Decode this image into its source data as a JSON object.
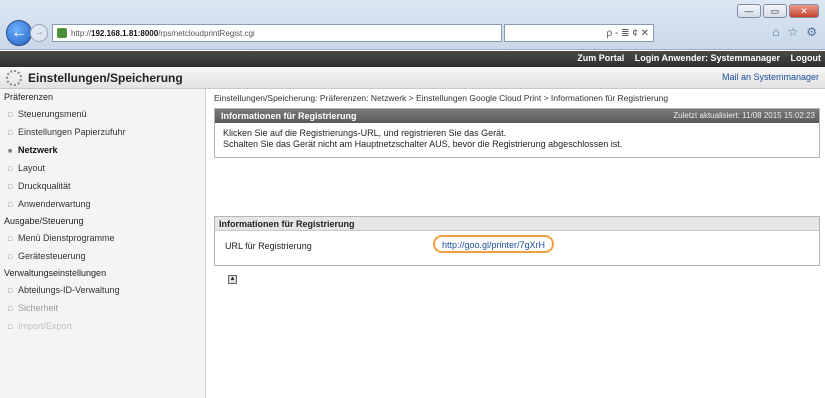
{
  "browser": {
    "url_host": "192.168.1.81:8000",
    "url_prefix": "http://",
    "url_path": "/rps/netcloudprintRegist.cgi",
    "search_tools": "ρ - ≣ ¢ ✕",
    "window_controls": [
      "—",
      "▭",
      "✕"
    ],
    "fav_icons": [
      "⌂",
      "☆",
      "⚙"
    ]
  },
  "topbar": {
    "portal_link": "Zum Portal",
    "login_user": "Login Anwender: Systemmanager",
    "logout": "Logout"
  },
  "header": {
    "title": "Einstellungen/Speicherung",
    "mail_admin": "Mail an Systemmanager"
  },
  "sidebar": {
    "sections": [
      {
        "heading": "Präferenzen",
        "items": [
          {
            "label": "Steuerungsmenü",
            "state": "normal"
          },
          {
            "label": "Einstellungen Papierzufuhr",
            "state": "normal"
          },
          {
            "label": "Netzwerk",
            "state": "active"
          },
          {
            "label": "Layout",
            "state": "normal"
          },
          {
            "label": "Druckqualität",
            "state": "normal"
          },
          {
            "label": "Anwenderwartung",
            "state": "normal"
          }
        ]
      },
      {
        "heading": "Ausgabe/Steuerung",
        "items": [
          {
            "label": "Menü Dienstprogramme",
            "state": "normal"
          },
          {
            "label": "Gerätesteuerung",
            "state": "normal"
          }
        ]
      },
      {
        "heading": "Verwaltungseinstellungen",
        "items": [
          {
            "label": "Abteilungs-ID-Verwaltung",
            "state": "normal"
          },
          {
            "label": "Sicherheit",
            "state": "faded"
          },
          {
            "label": "Import/Export",
            "state": "faded2"
          }
        ]
      }
    ]
  },
  "main": {
    "breadcrumb": "Einstellungen/Speicherung: Präferenzen: Netzwerk > Einstellungen Google Cloud Print > Informationen für Registrierung",
    "info_panel": {
      "title": "Informationen für Registrierung",
      "updated": "Zuletzt aktualisiert: 11/08 2015 15:02:23",
      "line1": "Klicken Sie auf die Registrierungs-URL, und registrieren Sie das Gerät.",
      "line2": "Schalten Sie das Gerät nicht am Hauptnetzschalter AUS, bevor die Registrierung abgeschlossen ist."
    },
    "reg_panel": {
      "title": "Informationen für Registrierung",
      "label": "URL für Registrierung",
      "url": "http://goo.gl/printer/7gXrH"
    },
    "to_top_icon": "▲"
  }
}
